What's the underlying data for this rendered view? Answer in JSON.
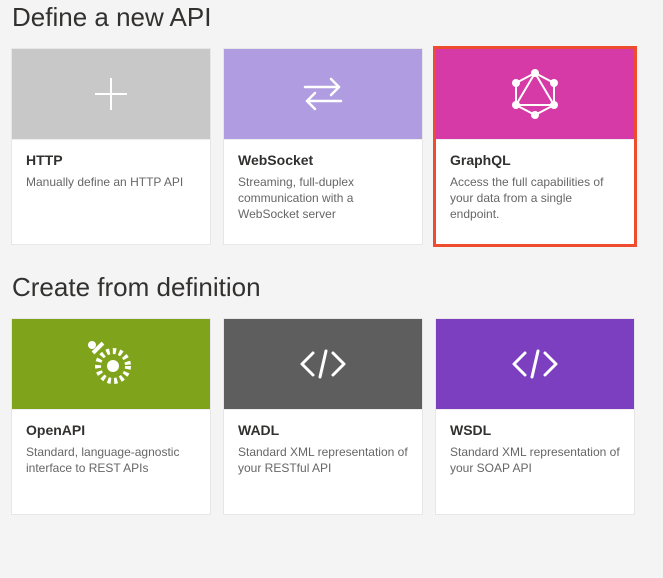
{
  "sections": {
    "define": {
      "title": "Define a new API"
    },
    "create": {
      "title": "Create from definition"
    }
  },
  "cards": {
    "http": {
      "title": "HTTP",
      "desc": "Manually define an HTTP API"
    },
    "ws": {
      "title": "WebSocket",
      "desc": "Streaming, full-duplex communication with a WebSocket server"
    },
    "gql": {
      "title": "GraphQL",
      "desc": "Access the full capabilities of your data from a single endpoint."
    },
    "oapi": {
      "title": "OpenAPI",
      "desc": "Standard, language-agnostic interface to REST APIs"
    },
    "wadl": {
      "title": "WADL",
      "desc": "Standard XML representation of your RESTful API"
    },
    "wsdl": {
      "title": "WSDL",
      "desc": "Standard XML representation of your SOAP API"
    }
  }
}
